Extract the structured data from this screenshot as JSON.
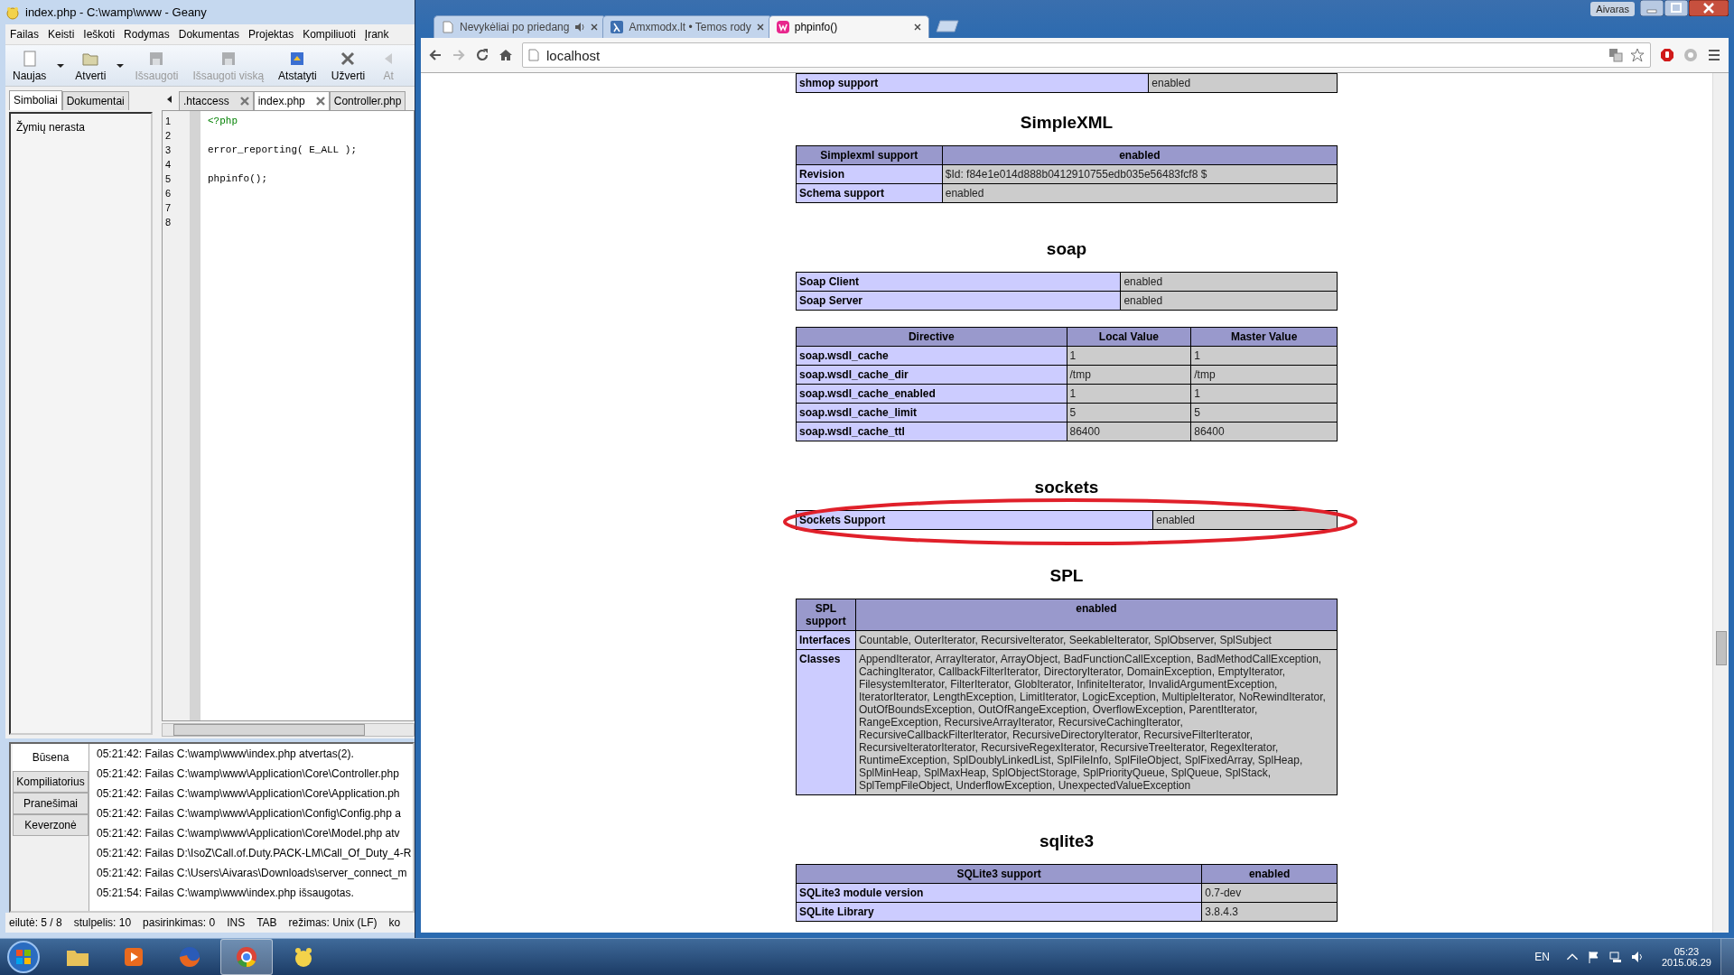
{
  "geany": {
    "title": "index.php - C:\\wamp\\www - Geany",
    "menu": [
      "Failas",
      "Keisti",
      "Ieškoti",
      "Rodymas",
      "Dokumentas",
      "Projektas",
      "Kompiliuoti",
      "Įrank"
    ],
    "toolbar": [
      {
        "label": "Naujas",
        "kind": "new",
        "disabled": false,
        "dropdown": true
      },
      {
        "label": "Atverti",
        "kind": "open",
        "disabled": false,
        "dropdown": true
      },
      {
        "label": "Išsaugoti",
        "kind": "save",
        "disabled": true,
        "dropdown": false
      },
      {
        "label": "Išsaugoti viską",
        "kind": "saveall",
        "disabled": true,
        "dropdown": false
      },
      {
        "label": "Atstatyti",
        "kind": "revert",
        "disabled": false,
        "dropdown": false
      },
      {
        "label": "Užverti",
        "kind": "close",
        "disabled": false,
        "dropdown": false
      },
      {
        "label": "At",
        "kind": "back",
        "disabled": true,
        "dropdown": false
      }
    ],
    "sidebar_tabs": [
      {
        "label": "Simboliai",
        "selected": true
      },
      {
        "label": "Dokumentai",
        "selected": false
      }
    ],
    "symbols_text": "Žymių nerasta",
    "editor_tabs": [
      {
        "label": ".htaccess",
        "selected": false,
        "closable": true
      },
      {
        "label": "index.php",
        "selected": true,
        "closable": true
      },
      {
        "label": "Controller.php",
        "selected": false,
        "closable": false
      }
    ],
    "code_lines": [
      {
        "number": "1",
        "text": "<?php",
        "kind": "tag"
      },
      {
        "number": "2"
      },
      {
        "number": "3",
        "text": "error_reporting( E_ALL );",
        "kind": "code"
      },
      {
        "number": "4"
      },
      {
        "number": "5",
        "text": "phpinfo();",
        "kind": "code"
      },
      {
        "number": "6"
      },
      {
        "number": "7"
      },
      {
        "number": "8"
      }
    ],
    "message_tabs": [
      {
        "label": "Būsena",
        "selected": true
      },
      {
        "label": "Kompiliatorius",
        "selected": false
      },
      {
        "label": "Pranešimai",
        "selected": false
      },
      {
        "label": "Keverzonė",
        "selected": false
      }
    ],
    "messages": [
      "05:21:42: Failas C:\\wamp\\www\\index.php atvertas(2).",
      "05:21:42: Failas C:\\wamp\\www\\Application\\Core\\Controller.php",
      "05:21:42: Failas C:\\wamp\\www\\Application\\Core\\Application.ph",
      "05:21:42: Failas C:\\wamp\\www\\Application\\Config\\Config.php a",
      "05:21:42: Failas C:\\wamp\\www\\Application\\Core\\Model.php atv",
      "05:21:42: Failas D:\\IsoZ\\Call.of.Duty.PACK-LM\\Call_Of_Duty_4-R",
      "05:21:42: Failas C:\\Users\\Aivaras\\Downloads\\server_connect_m",
      "05:21:54: Failas C:\\wamp\\www\\index.php išsaugotas."
    ],
    "status": [
      "eilutė: 5 / 8",
      "stulpelis: 10",
      "pasirinkimas: 0",
      "INS",
      "TAB",
      "režimas: Unix (LF)",
      "ko"
    ]
  },
  "browser": {
    "user": "Aivaras",
    "tabs": [
      {
        "title": "Nevykėliai po priedang",
        "selected": false,
        "audio": true,
        "kind": "page"
      },
      {
        "title": "Amxmodx.lt • Temos rody",
        "selected": false,
        "audio": false,
        "kind": "lambda"
      },
      {
        "title": "phpinfo()",
        "selected": true,
        "audio": false,
        "kind": "wamp"
      }
    ],
    "url": "localhost",
    "top_row": [
      "shmop support",
      "enabled"
    ],
    "sections": [
      {
        "title": "SimpleXML",
        "tables": [
          {
            "highlighted": false,
            "header": [
              "Simplexml support",
              "enabled"
            ],
            "rows": [
              [
                "Revision",
                "$Id: f84e1e014d888b0412910755edb035e56483fcf8 $"
              ],
              [
                "Schema support",
                "enabled"
              ]
            ]
          }
        ]
      },
      {
        "title": "soap",
        "tables": [
          {
            "highlighted": false,
            "rows": [
              [
                "Soap Client",
                "enabled"
              ],
              [
                "Soap Server",
                "enabled"
              ]
            ]
          },
          {
            "highlighted": false,
            "header": [
              "Directive",
              "Local Value",
              "Master Value"
            ],
            "rows": [
              [
                "soap.wsdl_cache",
                "1",
                "1"
              ],
              [
                "soap.wsdl_cache_dir",
                "/tmp",
                "/tmp"
              ],
              [
                "soap.wsdl_cache_enabled",
                "1",
                "1"
              ],
              [
                "soap.wsdl_cache_limit",
                "5",
                "5"
              ],
              [
                "soap.wsdl_cache_ttl",
                "86400",
                "86400"
              ]
            ]
          }
        ]
      },
      {
        "title": "sockets",
        "tables": [
          {
            "highlighted": true,
            "rows": [
              [
                "Sockets Support",
                "enabled"
              ]
            ]
          }
        ]
      },
      {
        "title": "SPL",
        "tables": [
          {
            "highlighted": false,
            "header": [
              "SPL support",
              "enabled"
            ],
            "rows": [
              [
                "Interfaces",
                "Countable, OuterIterator, RecursiveIterator, SeekableIterator, SplObserver, SplSubject"
              ],
              [
                "Classes",
                "AppendIterator, ArrayIterator, ArrayObject, BadFunctionCallException, BadMethodCallException, CachingIterator, CallbackFilterIterator, DirectoryIterator, DomainException, EmptyIterator, FilesystemIterator, FilterIterator, GlobIterator, InfiniteIterator, InvalidArgumentException, IteratorIterator, LengthException, LimitIterator, LogicException, MultipleIterator, NoRewindIterator, OutOfBoundsException, OutOfRangeException, OverflowException, ParentIterator, RangeException, RecursiveArrayIterator, RecursiveCachingIterator, RecursiveCallbackFilterIterator, RecursiveDirectoryIterator, RecursiveFilterIterator, RecursiveIteratorIterator, RecursiveRegexIterator, RecursiveTreeIterator, RegexIterator, RuntimeException, SplDoublyLinkedList, SplFileInfo, SplFileObject, SplFixedArray, SplHeap, SplMinHeap, SplMaxHeap, SplObjectStorage, SplPriorityQueue, SplQueue, SplStack, SplTempFileObject, UnderflowException, UnexpectedValueException"
              ]
            ]
          }
        ]
      },
      {
        "title": "sqlite3",
        "tables": [
          {
            "highlighted": false,
            "header": [
              "SQLite3 support",
              "enabled"
            ],
            "rows": [
              [
                "SQLite3 module version",
                "0.7-dev"
              ],
              [
                "SQLite Library",
                "3.8.4.3"
              ]
            ]
          }
        ]
      }
    ]
  },
  "taskbar": {
    "apps": [
      {
        "kind": "folder",
        "active": false
      },
      {
        "kind": "media",
        "active": false
      },
      {
        "kind": "firefox",
        "active": false
      },
      {
        "kind": "chrome",
        "active": true
      },
      {
        "kind": "geany",
        "active": false
      }
    ],
    "language": "EN",
    "time": "05:23",
    "date": "2015.06.29"
  }
}
